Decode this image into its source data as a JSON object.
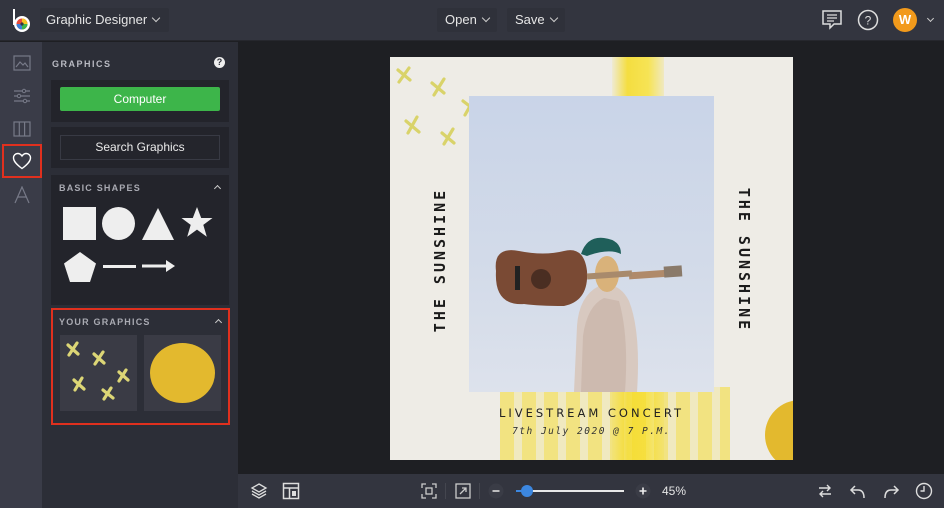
{
  "topbar": {
    "app_name": "Graphic Designer",
    "open_label": "Open",
    "save_label": "Save",
    "avatar_initial": "W"
  },
  "rail": {
    "items": [
      {
        "name": "image"
      },
      {
        "name": "adjustments"
      },
      {
        "name": "frames"
      },
      {
        "name": "graphics",
        "selected": true
      },
      {
        "name": "text"
      }
    ]
  },
  "panel": {
    "title": "GRAPHICS",
    "help": "?",
    "computer_button": "Computer",
    "search_button": "Search Graphics",
    "basic_shapes": {
      "title": "BASIC SHAPES",
      "shapes": [
        "square",
        "circle",
        "triangle",
        "star",
        "pentagon",
        "line",
        "arrow"
      ]
    },
    "your_graphics": {
      "title": "YOUR GRAPHICS",
      "items": [
        "yellow-crosses",
        "yellow-circle"
      ]
    }
  },
  "poster": {
    "vertical_text_left": "THE SUNSHINE",
    "vertical_text_right": "THE SUNSHINE",
    "headline": "LIVESTREAM CONCERT",
    "date_line": "7th July 2020 @ 7 P.M.",
    "colors": {
      "accent_yellow": "#f5dc2e",
      "cross_yellow": "#d9d36a",
      "circle_gold": "#e3b92e",
      "sky": "#cdd8ea"
    }
  },
  "bottombar": {
    "zoom_value": 0.1,
    "zoom_percent": "45%"
  },
  "colors": {
    "accent_green": "#3db54a",
    "highlight_red": "#e0301e",
    "avatar_orange": "#f29a1b",
    "slider_blue": "#3c87e0"
  }
}
